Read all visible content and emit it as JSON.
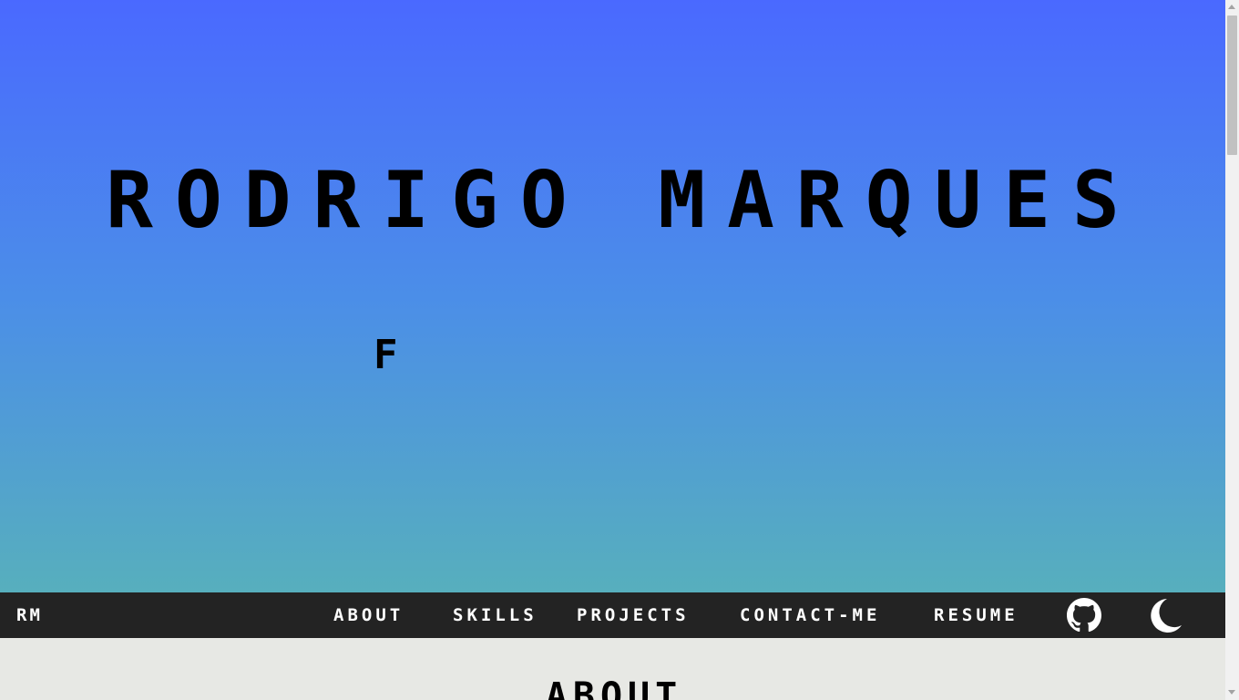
{
  "hero": {
    "title": "RODRIGO MARQUES",
    "typing_text": "F"
  },
  "navbar": {
    "logo": "RM",
    "links": [
      "ABOUT",
      "SKILLS",
      "PROJECTS",
      "CONTACT-ME",
      "RESUME"
    ],
    "icons": [
      "github-icon",
      "moon-icon"
    ]
  },
  "about": {
    "title": "ABOUT"
  },
  "colors": {
    "gradient_top": "#4a69ff",
    "gradient_bottom": "#57afbd",
    "navbar_bg": "#232323",
    "section_bg": "#e7e8e4"
  }
}
